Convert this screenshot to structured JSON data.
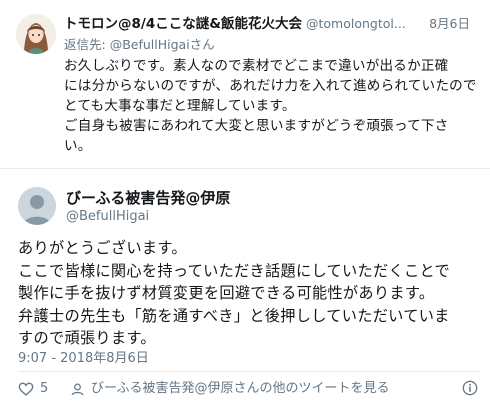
{
  "reply_tweet": {
    "display_name": "トモロン@8/4ここな謎&飯能花火大会",
    "handle": "@tomolongtol...",
    "date": "8月6日",
    "reply_to_prefix": "返信先: ",
    "reply_to_handle": "@BefullHigai",
    "reply_to_suffix": "さん",
    "body_lines": [
      "お久しぶりです。素人なので素材でどこまで違いが出るか正確",
      "には分からないのですが、あれだけ力を入れて進められていたので",
      "とても大事な事だと理解しています。",
      "ご自身も被害にあわれて大変と思いますがどうぞ頑張って下さ",
      "い。"
    ]
  },
  "main_tweet": {
    "display_name": "びーふる被害告発@伊原",
    "handle": "@BefullHigai",
    "body_lines": [
      "ありがとうございます。",
      "ここで皆様に関心を持っていただき話題にしていただくことで",
      "製作に手を抜けず材質変更を回避できる可能性があります。",
      "弁護士の先生も「筋を通すべき」と後押ししていただいていま",
      "すので頑張ります。"
    ],
    "timestamp": "9:07 - 2018年8月6日",
    "like_count": "5",
    "more_tweets_label": "びーふる被害告発@伊原さんの他のツイートを見る"
  },
  "colors": {
    "text": "#14171a",
    "secondary": "#657786",
    "divider": "#e6ecf0",
    "default_avatar": "#ccd6dd"
  },
  "icons": [
    "heart-icon",
    "person-icon",
    "info-icon",
    "default-avatar-icon"
  ]
}
